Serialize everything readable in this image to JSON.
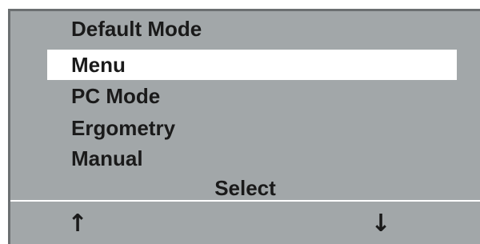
{
  "screen": {
    "title": "Default Mode",
    "menu_items": [
      {
        "label": "Menu",
        "selected": true
      },
      {
        "label": "PC Mode",
        "selected": false
      },
      {
        "label": "Ergometry",
        "selected": false
      },
      {
        "label": "Manual",
        "selected": false
      }
    ],
    "action_label": "Select",
    "softkeys": {
      "left": {
        "icon": "up-arrow-icon",
        "glyph": "↑"
      },
      "right": {
        "icon": "down-arrow-icon",
        "glyph": "↓"
      }
    }
  },
  "colors": {
    "screen_background": "#a2a7a9",
    "selection_highlight": "#ffffff",
    "text": "#1a1a1a"
  }
}
